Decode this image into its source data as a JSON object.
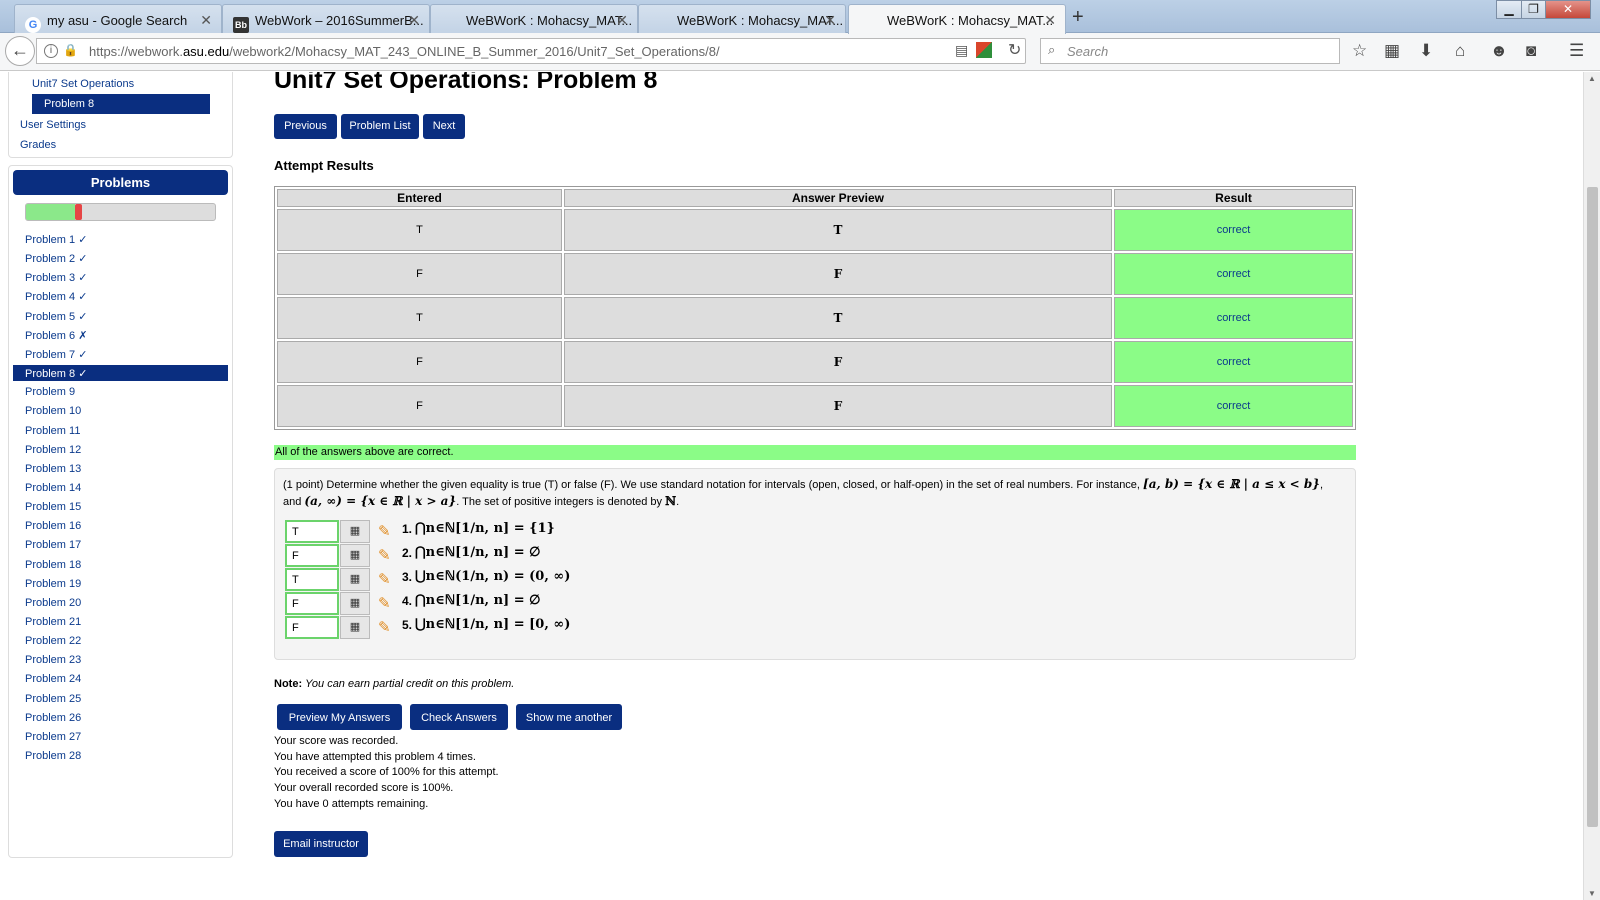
{
  "browser": {
    "tabs": [
      {
        "title": "my asu - Google Search",
        "favicon": "G",
        "active": false
      },
      {
        "title": "WebWork – 2016SummerB...",
        "favicon": "Bb",
        "active": false
      },
      {
        "title": "WeBWorK : Mohacsy_MAT...",
        "favicon": "",
        "active": false
      },
      {
        "title": "WeBWorK : Mohacsy_MAT...",
        "favicon": "",
        "active": false
      },
      {
        "title": "WeBWorK : Mohacsy_MAT...",
        "favicon": "",
        "active": true
      }
    ],
    "url_prefix": "https://webwork.",
    "url_host": "asu.edu",
    "url_path": "/webwork2/Mohacsy_MAT_243_ONLINE_B_Summer_2016/Unit7_Set_Operations/8/",
    "search_placeholder": "Search"
  },
  "sidebar": {
    "set_link": "Unit7 Set Operations",
    "current_problem": "Problem 8",
    "user_settings": "User Settings",
    "grades": "Grades",
    "problems_heading": "Problems",
    "progress_correct_fraction": 0.26,
    "problems": [
      "Problem 1 ✓",
      "Problem 2 ✓",
      "Problem 3 ✓",
      "Problem 4 ✓",
      "Problem 5 ✓",
      "Problem 6 ✗",
      "Problem 7 ✓",
      "Problem 8 ✓",
      "Problem 9",
      "Problem 10",
      "Problem 11",
      "Problem 12",
      "Problem 13",
      "Problem 14",
      "Problem 15",
      "Problem 16",
      "Problem 17",
      "Problem 18",
      "Problem 19",
      "Problem 20",
      "Problem 21",
      "Problem 22",
      "Problem 23",
      "Problem 24",
      "Problem 25",
      "Problem 26",
      "Problem 27",
      "Problem 28"
    ]
  },
  "main": {
    "title": "Unit7 Set Operations: Problem 8",
    "nav": {
      "previous": "Previous",
      "problem_list": "Problem List",
      "next": "Next"
    },
    "attempt_heading": "Attempt Results",
    "results_headers": [
      "Entered",
      "Answer Preview",
      "Result"
    ],
    "results": [
      {
        "entered": "T",
        "preview": "T",
        "result": "correct"
      },
      {
        "entered": "F",
        "preview": "F",
        "result": "correct"
      },
      {
        "entered": "T",
        "preview": "T",
        "result": "correct"
      },
      {
        "entered": "F",
        "preview": "F",
        "result": "correct"
      },
      {
        "entered": "F",
        "preview": "F",
        "result": "correct"
      }
    ],
    "all_correct": "All of the answers above are correct.",
    "problem": {
      "intro": "(1 point) Determine whether the given equality is true (T) or false (F). We use standard notation for intervals (open, closed, or half-open) in the set of real numbers. For instance, ",
      "example1": "[a, b) = {x ∈ ℝ | a ≤ x < b}",
      "and": ", and",
      "example2": "(a, ∞) = {x ∈ ℝ | x > a}",
      "tail": ". The set of positive integers is denoted by ",
      "naturals": "ℕ",
      "end": "."
    },
    "answers": [
      {
        "value": "T",
        "label": "1.",
        "equation": "⋂n∈ℕ[1/n, n] = {1}"
      },
      {
        "value": "F",
        "label": "2.",
        "equation": "⋂n∈ℕ[1/n, n] = ∅"
      },
      {
        "value": "T",
        "label": "3.",
        "equation": "⋃n∈ℕ(1/n, n) = (0, ∞)"
      },
      {
        "value": "F",
        "label": "4.",
        "equation": "⋂n∈ℕ[1/n, n] = ∅"
      },
      {
        "value": "F",
        "label": "5.",
        "equation": "⋃n∈ℕ[1/n, n] = [0, ∞)"
      }
    ],
    "note_label": "Note:",
    "note_text": "You can earn partial credit on this problem.",
    "buttons": {
      "preview": "Preview My Answers",
      "check": "Check Answers",
      "another": "Show me another"
    },
    "score_lines": [
      "Your score was recorded.",
      "You have attempted this problem 4 times.",
      "You received a score of 100% for this attempt.",
      "Your overall recorded score is 100%.",
      "You have 0 attempts remaining."
    ],
    "email_instructor": "Email instructor"
  },
  "colors": {
    "brand": "#0a2e80",
    "correct": "#8bfc87",
    "link": "#0b3a8c"
  }
}
